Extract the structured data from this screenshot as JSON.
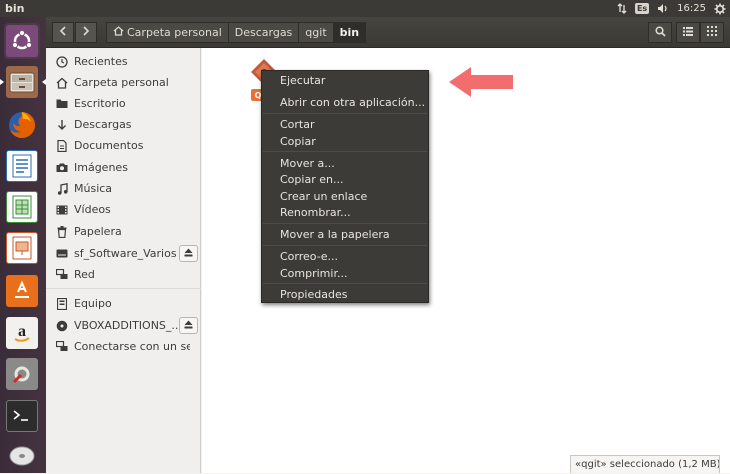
{
  "window": {
    "title": "bin"
  },
  "tray": {
    "keyboard_layout": "Es",
    "time": "16:25"
  },
  "launcher": {
    "items": [
      {
        "name": "ubuntu-dash",
        "color": "#dd4814"
      },
      {
        "name": "files",
        "color": "#a7714f"
      },
      {
        "name": "firefox",
        "color": "#e66000"
      },
      {
        "name": "writer",
        "color": "#2a6fb4"
      },
      {
        "name": "calc",
        "color": "#3a8f3a"
      },
      {
        "name": "impress",
        "color": "#c8572a"
      },
      {
        "name": "software-center",
        "color": "#e8701c"
      },
      {
        "name": "amazon",
        "color": "#f2f1ed"
      },
      {
        "name": "system-settings",
        "color": "#8a8a88"
      },
      {
        "name": "terminal",
        "color": "#2c2c2c"
      },
      {
        "name": "dvd",
        "color": "#cfcfcf"
      }
    ]
  },
  "headerbar": {
    "back_icon": "chevron-left-icon",
    "forward_icon": "chevron-right-icon",
    "breadcrumbs": [
      {
        "label": "Carpeta personal",
        "icon": "home-icon"
      },
      {
        "label": "Descargas"
      },
      {
        "label": "qgit"
      },
      {
        "label": "bin",
        "current": true
      }
    ],
    "tools": [
      "search-icon",
      "list-view-icon",
      "grid-view-icon"
    ]
  },
  "sidebar": {
    "items": [
      {
        "label": "Recientes",
        "icon": "clock-icon"
      },
      {
        "label": "Carpeta personal",
        "icon": "home-icon"
      },
      {
        "label": "Escritorio",
        "icon": "folder-icon"
      },
      {
        "label": "Descargas",
        "icon": "download-icon"
      },
      {
        "label": "Documentos",
        "icon": "document-icon"
      },
      {
        "label": "Imágenes",
        "icon": "camera-icon"
      },
      {
        "label": "Música",
        "icon": "music-icon"
      },
      {
        "label": "Vídeos",
        "icon": "video-icon"
      },
      {
        "label": "Papelera",
        "icon": "trash-icon"
      },
      {
        "label": "sf_Software_Varios",
        "icon": "drive-icon",
        "eject": true
      },
      {
        "label": "Red",
        "icon": "network-icon"
      },
      {
        "label": "Equipo",
        "icon": "computer-icon"
      },
      {
        "label": "VBOXADDITIONS_...",
        "icon": "disc-icon",
        "eject": true
      },
      {
        "label": "Conectarse con un servi...",
        "icon": "connect-icon"
      }
    ]
  },
  "content": {
    "file": {
      "label_initial": "Q"
    }
  },
  "context_menu": {
    "groups": [
      [
        "Ejecutar",
        "Abrir con otra aplicación..."
      ],
      [
        "Cortar",
        "Copiar"
      ],
      [
        "Mover a...",
        "Copiar en...",
        "Crear un enlace",
        "Renombrar..."
      ],
      [
        "Mover a la papelera"
      ],
      [
        "Correo-e...",
        "Comprimir..."
      ],
      [
        "Propiedades"
      ]
    ]
  },
  "statusbar": {
    "text": "«qgit» seleccionado  (1,2 MB)"
  },
  "colors": {
    "accent_arrow": "#f26d6d",
    "file_label": "#e6723a",
    "menu_bg": "#3c3b37"
  }
}
